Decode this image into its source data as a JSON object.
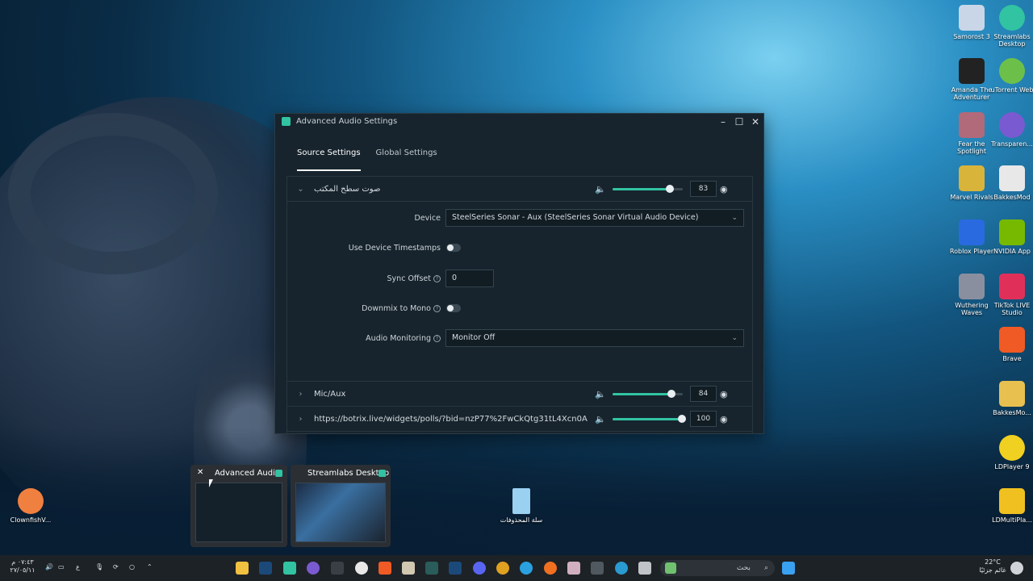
{
  "window": {
    "title": "Advanced Audio Settings",
    "minimize_icon": "minimize-icon",
    "maximize_icon": "maximize-icon",
    "close_icon": "close-icon",
    "tabs": [
      {
        "label": "Source Settings",
        "active": true
      },
      {
        "label": "Global Settings",
        "active": false
      }
    ],
    "sources": [
      {
        "name": "صوت سطح المكتب",
        "volume": 83,
        "expanded": true
      },
      {
        "name": "Mic/Aux",
        "volume": 84,
        "expanded": false
      },
      {
        "name": "https://botrix.live/widgets/polls/?bid=nzP77%2FwCkQtg31tL4Xcn0A",
        "volume": 100,
        "expanded": false
      }
    ],
    "settings": {
      "device_label": "Device",
      "device_value": "SteelSeries Sonar - Aux (SteelSeries Sonar Virtual Audio Device)",
      "timestamps_label": "Use Device Timestamps",
      "timestamps_on": false,
      "sync_label": "Sync Offset",
      "sync_value": "0",
      "downmix_label": "Downmix to Mono",
      "downmix_on": false,
      "monitoring_label": "Audio Monitoring",
      "monitoring_value": "Monitor Off"
    },
    "accent": "#31c3a2"
  },
  "desktop_icons": [
    {
      "label": "Samorost 3",
      "color": "#c9d6e8"
    },
    {
      "label": "Streamlabs Desktop",
      "color": "#31c3a2"
    },
    {
      "label": "Amanda The Adventurer",
      "color": "#222222"
    },
    {
      "label": "uTorrent Web",
      "color": "#6cc04a"
    },
    {
      "label": "Fear the Spotlight",
      "color": "#b06a7a"
    },
    {
      "label": "Transparen...",
      "color": "#7a5ad0"
    },
    {
      "label": "Marvel Rivals",
      "color": "#d8b43a"
    },
    {
      "label": "BakkesMod",
      "color": "#e8e8e8"
    },
    {
      "label": "Roblox Player",
      "color": "#2a6ae0"
    },
    {
      "label": "NVIDIA App",
      "color": "#76b900"
    },
    {
      "label": "Wuthering Waves",
      "color": "#8a8fa0"
    },
    {
      "label": "TikTok LIVE Studio",
      "color": "#e0305a"
    },
    {
      "label": "Brave",
      "color": "#f05a24"
    },
    {
      "label": "BakkesMo...",
      "color": "#e8c050"
    },
    {
      "label": "LDPlayer 9",
      "color": "#f0d020"
    },
    {
      "label": "LDMultiPla...",
      "color": "#f0c020"
    },
    {
      "label": "ClownfishV...",
      "color": "#f08040"
    },
    {
      "label": "سلة المحذوفات",
      "color": "#9ad0f0"
    }
  ],
  "task_previews": [
    {
      "title": "Advanced Audi...",
      "close_icon": "close-icon"
    },
    {
      "title": "Streamlabs Desktop"
    }
  ],
  "taskbar": {
    "search_placeholder": "بحث",
    "weather_temp": "22°C",
    "weather_text": "غائم جزئيًا",
    "time": "٠٧:٤٣ م",
    "date": "٢٧/٠٥/١١",
    "lang": "ع"
  }
}
